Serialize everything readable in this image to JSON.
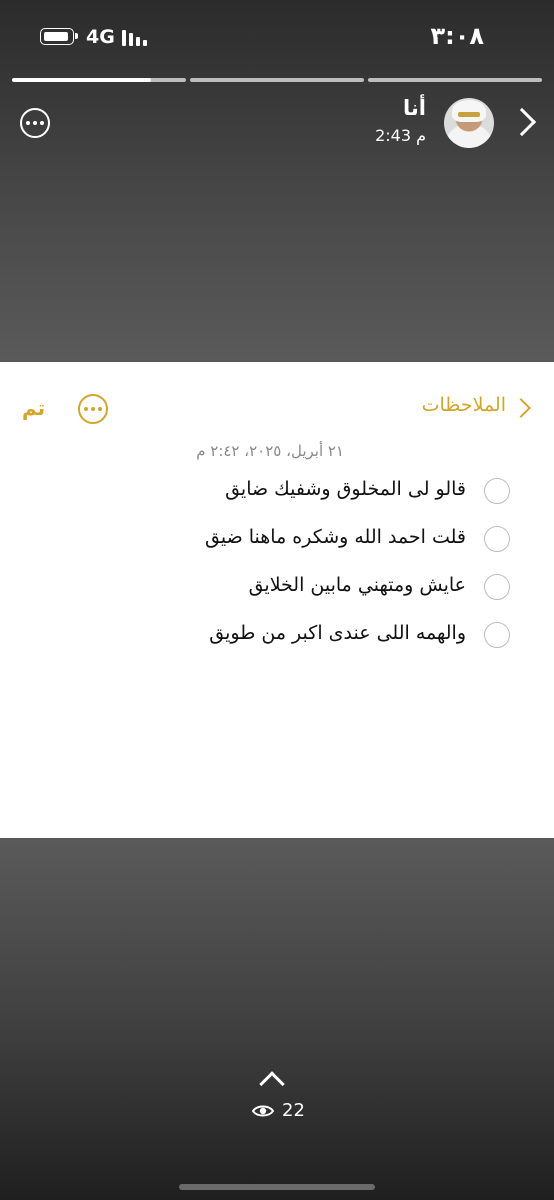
{
  "status_bar": {
    "time": "٣:٠٨",
    "network": "4G",
    "icons": [
      "battery-icon",
      "signal-bars-icon"
    ]
  },
  "story": {
    "progress_segments": [
      {
        "fill": 0.8
      },
      {
        "fill": 0
      },
      {
        "fill": 0
      }
    ],
    "user_name": "أنا",
    "post_time": "2:43 م",
    "view_count": "22",
    "icons": [
      "chevron-right-icon",
      "more-options-icon",
      "chevron-up-icon",
      "eye-icon"
    ]
  },
  "notes": {
    "back_label": "الملاحظات",
    "done_label": "تم",
    "date": "٢١ أبريل، ٢٠٢٥، ٢:٤٢ م",
    "accent_color": "#d3a52b",
    "items": [
      {
        "text": "قالو لى المخلوق وشفيك ضايق",
        "checked": false
      },
      {
        "text": "قلت احمد الله وشكره ماهنا ضيق",
        "checked": false
      },
      {
        "text": "عايش ومتهني مابين الخلايق",
        "checked": false
      },
      {
        "text": "والهمه اللى عندى اكبر من طويق",
        "checked": false
      }
    ]
  }
}
